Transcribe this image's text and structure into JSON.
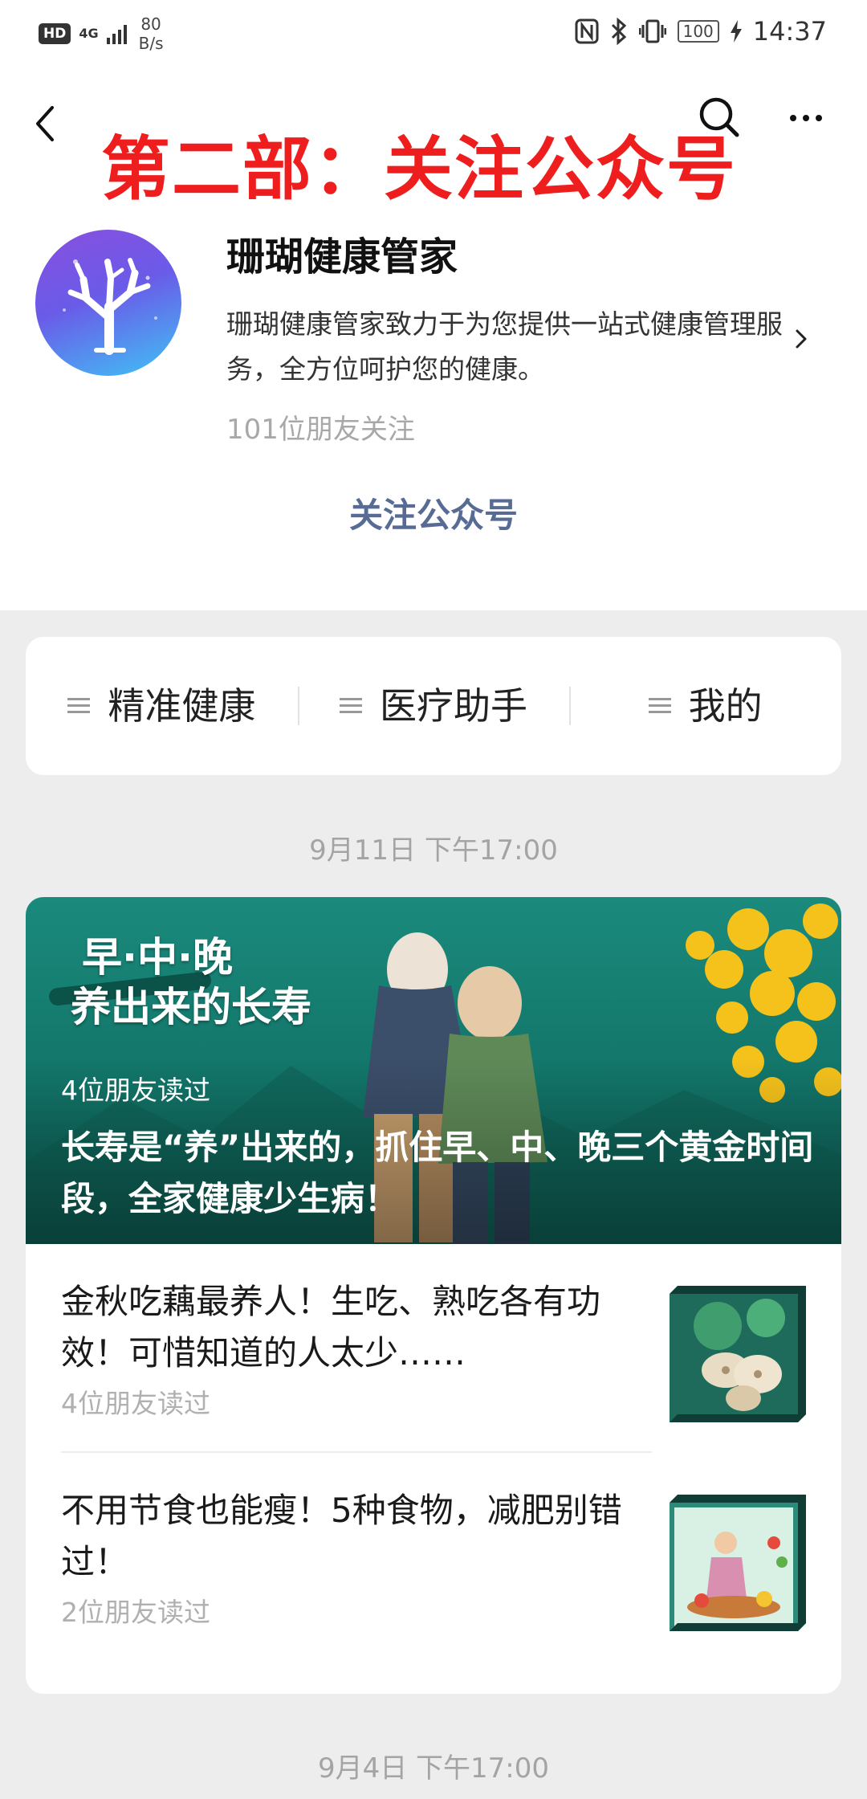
{
  "status_bar": {
    "hd": "HD",
    "network": "4G",
    "speed_value": "80",
    "speed_unit": "B/s",
    "battery": "100",
    "time": "14:37"
  },
  "header": {
    "overlay_title": "第二部：关注公众号"
  },
  "account": {
    "name": "珊瑚健康管家",
    "description": "珊瑚健康管家致力于为您提供一站式健康管理服务，全方位呵护您的健康。",
    "followers": "101位朋友关注",
    "follow_label": "关注公众号"
  },
  "menu": {
    "items": [
      {
        "label": "精准健康"
      },
      {
        "label": "医疗助手"
      },
      {
        "label": "我的"
      }
    ]
  },
  "feed": {
    "date1": "9月11日 下午17:00",
    "date2": "9月4日 下午17:00",
    "cover": {
      "headline_line1": "早·中·晚",
      "headline_line2": "养出来的长寿",
      "read_count": "4位朋友读过",
      "title": "长寿是“养”出来的，抓住早、中、晚三个黄金时间段，全家健康少生病！"
    },
    "articles": [
      {
        "title": "金秋吃藕最养人！生吃、熟吃各有功效！可惜知道的人太少……",
        "read_count": "4位朋友读过"
      },
      {
        "title": "不用节食也能瘦！5种食物，减肥别错过！",
        "read_count": "2位朋友读过"
      }
    ]
  }
}
